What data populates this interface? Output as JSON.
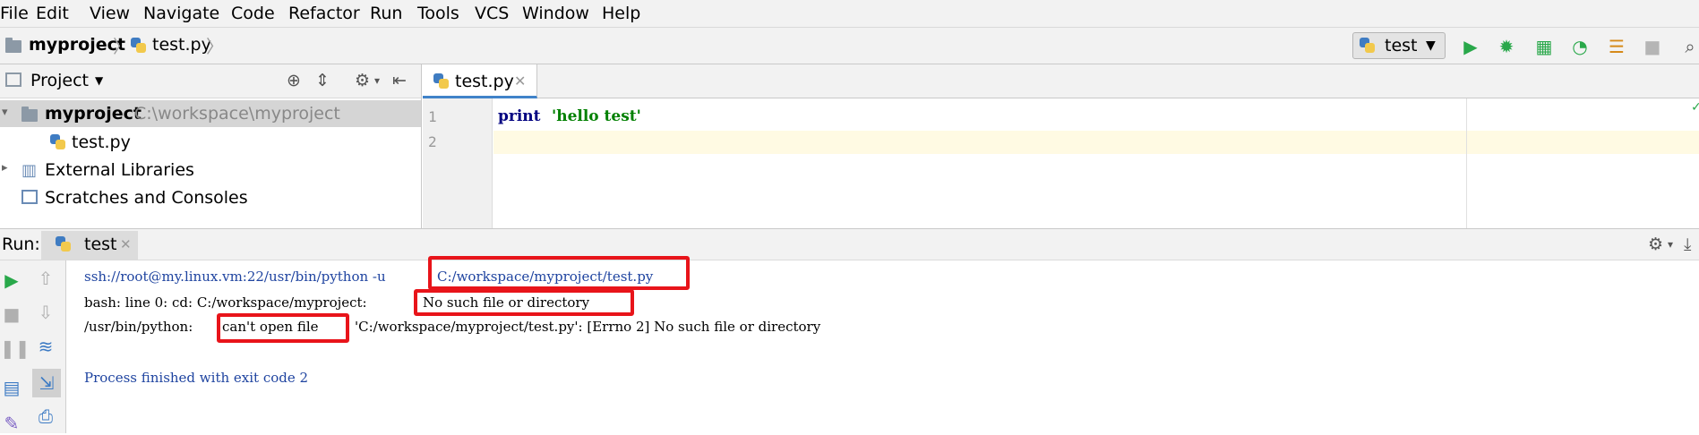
{
  "menu": [
    "File",
    "Edit",
    "View",
    "Navigate",
    "Code",
    "Refactor",
    "Run",
    "Tools",
    "VCS",
    "Window",
    "Help"
  ],
  "breadcrumb": {
    "project": "myproject",
    "file": "test.py"
  },
  "run_config": {
    "name": "test"
  },
  "project_panel": {
    "title": "Project",
    "tree": {
      "root": "myproject",
      "root_path": "C:\\workspace\\myproject",
      "file": "test.py",
      "libs": "External Libraries",
      "scratches": "Scratches and Consoles"
    }
  },
  "editor": {
    "tab": "test.py",
    "lines": {
      "n1": "1",
      "n2": "2"
    },
    "code": {
      "keyword": "print",
      "string": "'hello test'"
    }
  },
  "run_panel": {
    "label": "Run:",
    "tab": "test",
    "output": {
      "l1a": "ssh://root@my.linux.vm:22/usr/bin/python -u",
      "l1b": "C:/workspace/myproject/test.py",
      "l2a": "bash: line 0: cd: C:/workspace/myproject:",
      "l2b": "No such file or directory",
      "l3a": "/usr/bin/python:",
      "l3b": "can't open file",
      "l3c": "'C:/workspace/myproject/test.py': [Errno 2] No such file or directory",
      "l4": "Process finished with exit code 2"
    }
  },
  "colors": {
    "accent": "#4083c9",
    "highlight": "#e8141a",
    "run_green": "#29a84a"
  }
}
